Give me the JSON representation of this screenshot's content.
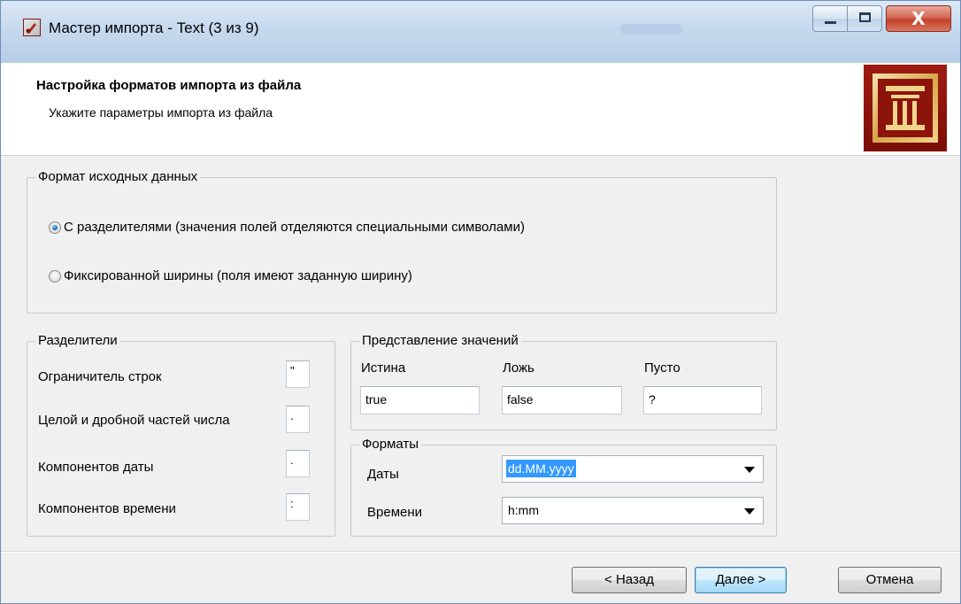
{
  "window": {
    "title": "Мастер импорта - Text (3 из 9)",
    "controls": {
      "minimize": "minimize",
      "maximize": "maximize",
      "close_glyph": "X"
    }
  },
  "header": {
    "title": "Настройка форматов импорта из файла",
    "subtitle": "Укажите параметры импорта из файла",
    "logo_icon": "columns-building-logo"
  },
  "source_format": {
    "legend": "Формат исходных данных",
    "options": [
      {
        "label": "С разделителями (значения полей отделяются специальными символами)",
        "checked": true
      },
      {
        "label": "Фиксированной ширины (поля имеют заданную ширину)",
        "checked": false
      }
    ]
  },
  "separators": {
    "legend": "Разделители",
    "rows": [
      {
        "label": "Ограничитель строк",
        "value": "\""
      },
      {
        "label": "Целой и дробной частей числа",
        "value": "."
      },
      {
        "label": "Компонентов даты",
        "value": "."
      },
      {
        "label": "Компонентов времени",
        "value": ":"
      }
    ]
  },
  "value_representation": {
    "legend": "Представление значений",
    "columns": [
      {
        "label": "Истина",
        "value": "true"
      },
      {
        "label": "Ложь",
        "value": "false"
      },
      {
        "label": "Пусто",
        "value": "?"
      }
    ]
  },
  "formats": {
    "legend": "Форматы",
    "date_label": "Даты",
    "date_value": "dd.MM.yyyy",
    "time_label": "Времени",
    "time_value": "h:mm"
  },
  "buttons": {
    "back": "< Назад",
    "next": "Далее >",
    "cancel": "Отмена"
  },
  "colors": {
    "accent_selection": "#3399ff",
    "logo_red": "#8c140a",
    "logo_gold": "#d7a54a"
  }
}
